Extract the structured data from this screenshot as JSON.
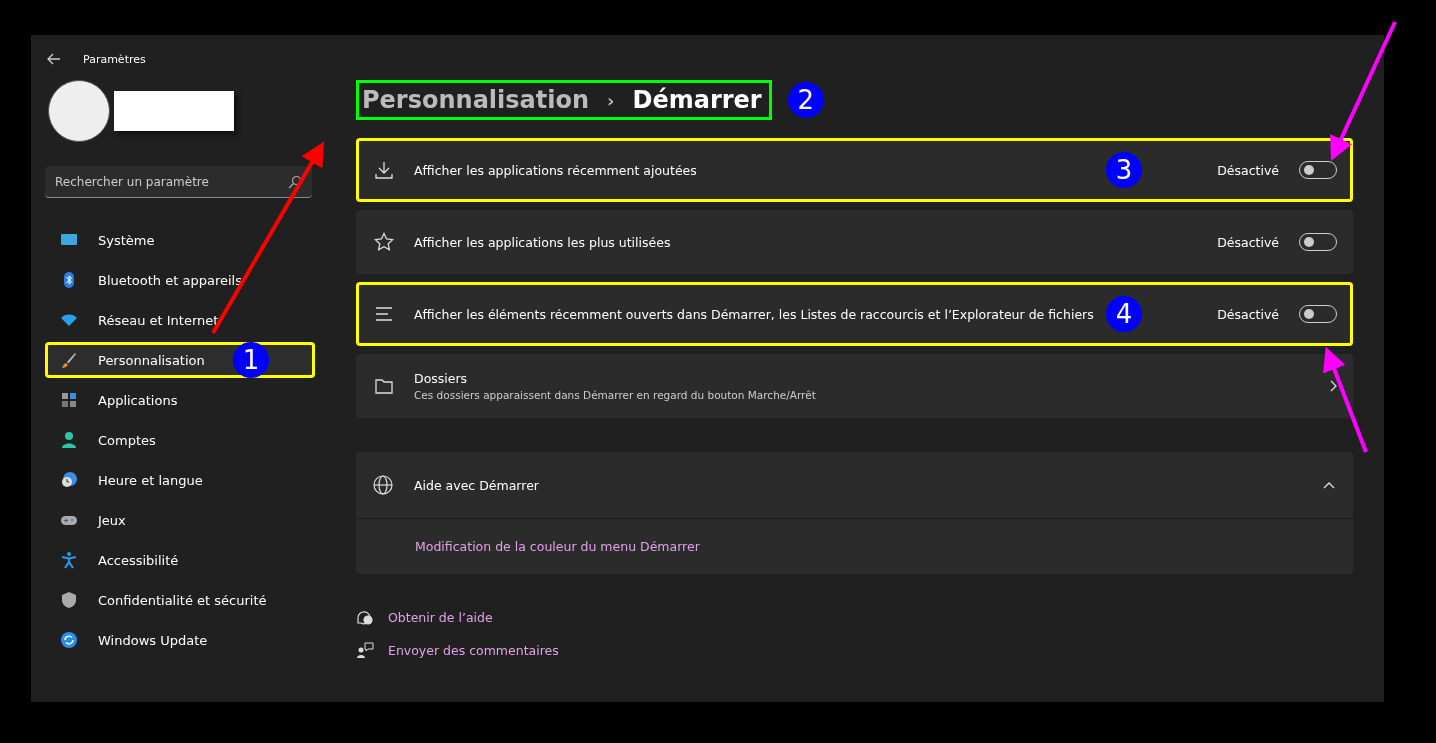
{
  "window": {
    "title": "Paramètres"
  },
  "search": {
    "placeholder": "Rechercher un paramètre"
  },
  "sidebar": {
    "items": [
      {
        "label": "Système",
        "selected": false,
        "highlighted": false
      },
      {
        "label": "Bluetooth et appareils",
        "selected": false,
        "highlighted": false
      },
      {
        "label": "Réseau et Internet",
        "selected": false,
        "highlighted": false
      },
      {
        "label": "Personnalisation",
        "selected": true,
        "highlighted": true,
        "badge": "1"
      },
      {
        "label": "Applications",
        "selected": false,
        "highlighted": false
      },
      {
        "label": "Comptes",
        "selected": false,
        "highlighted": false
      },
      {
        "label": "Heure et langue",
        "selected": false,
        "highlighted": false
      },
      {
        "label": "Jeux",
        "selected": false,
        "highlighted": false
      },
      {
        "label": "Accessibilité",
        "selected": false,
        "highlighted": false
      },
      {
        "label": "Confidentialité et sécurité",
        "selected": false,
        "highlighted": false
      },
      {
        "label": "Windows Update",
        "selected": false,
        "highlighted": false
      }
    ]
  },
  "breadcrumb": {
    "parent": "Personnalisation",
    "separator": "›",
    "current": "Démarrer",
    "highlighted": true,
    "badge": "2"
  },
  "settings": [
    {
      "kind": "toggle",
      "label": "Afficher les applications récemment ajoutées",
      "state_text": "Désactivé",
      "on": false,
      "highlighted": true,
      "badge": "3"
    },
    {
      "kind": "toggle",
      "label": "Afficher les applications les plus utilisées",
      "state_text": "Désactivé",
      "on": false,
      "highlighted": false
    },
    {
      "kind": "toggle",
      "label": "Afficher les éléments récemment ouverts dans Démarrer, les Listes de raccourcis et l’Explorateur de fichiers",
      "state_text": "Désactivé",
      "on": false,
      "highlighted": true,
      "badge": "4"
    },
    {
      "kind": "nav",
      "label": "Dossiers",
      "description": "Ces dossiers apparaissent dans Démarrer en regard du bouton Marche/Arrêt",
      "highlighted": false
    }
  ],
  "help": {
    "title": "Aide avec Démarrer",
    "expanded": true,
    "links": [
      "Modification de la couleur du menu Démarrer"
    ]
  },
  "footer_links": [
    "Obtenir de l’aide",
    "Envoyer des commentaires"
  ]
}
